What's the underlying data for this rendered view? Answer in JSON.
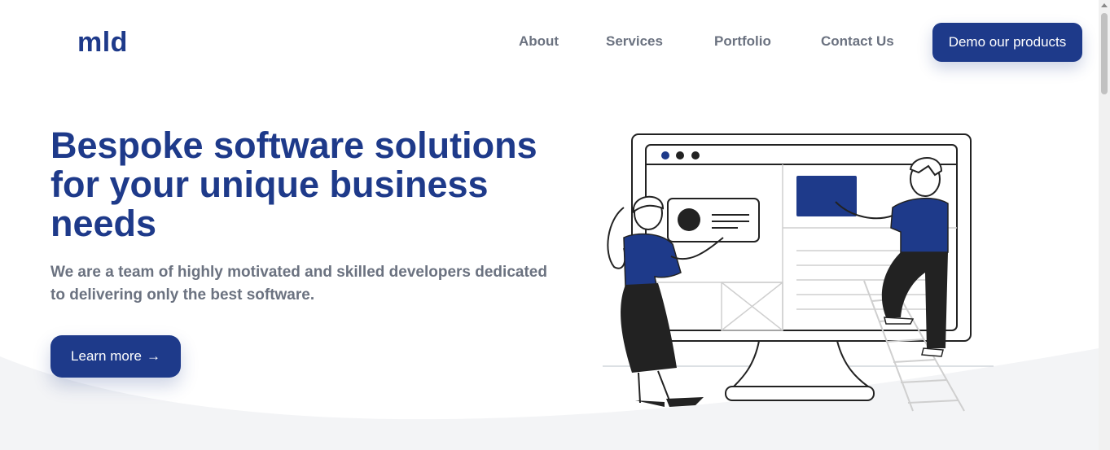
{
  "brand": {
    "logo": "mld"
  },
  "nav": {
    "links": [
      "About",
      "Services",
      "Portfolio",
      "Contact Us"
    ],
    "cta_label": "Demo our products"
  },
  "hero": {
    "title": "Bespoke software solutions for your unique business needs",
    "subtitle": "We are a team of highly motivated and skilled developers dedicated to delivering only the best software.",
    "button_label": "Learn more",
    "button_arrow": "→"
  },
  "colors": {
    "brand": "#1e3a8a",
    "text_muted": "#6b7280",
    "background_wave": "#f3f4f6"
  },
  "illustration": {
    "icon": "people-building-website-illustration"
  }
}
